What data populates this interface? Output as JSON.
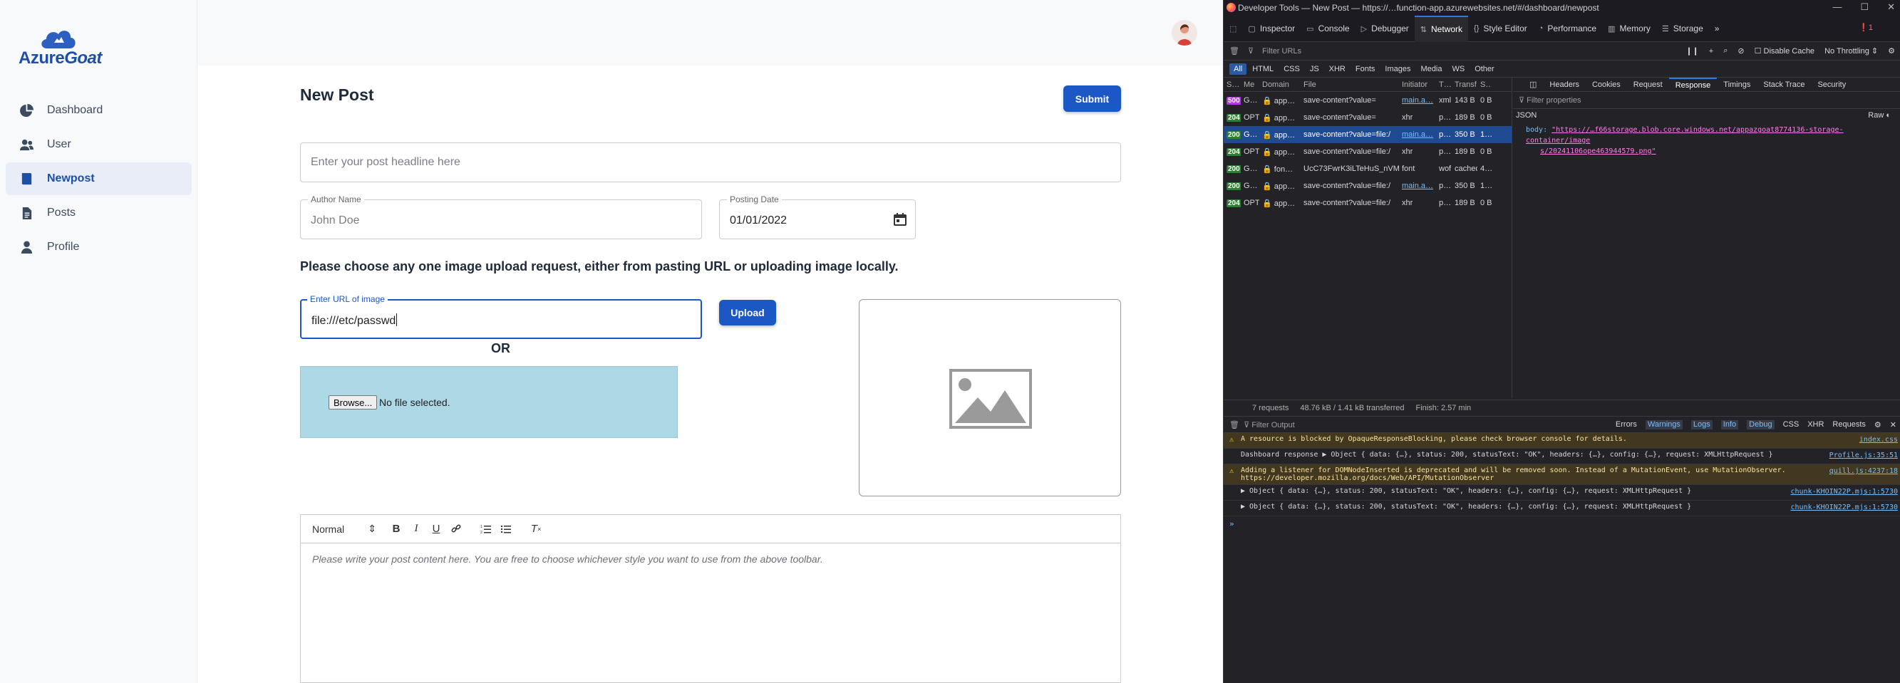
{
  "app": {
    "brand_main": "Azure",
    "brand_goat": "Goat",
    "nav": [
      {
        "label": "Dashboard",
        "icon": "pie-chart-icon"
      },
      {
        "label": "User",
        "icon": "users-icon"
      },
      {
        "label": "Newpost",
        "icon": "book-icon",
        "active": true
      },
      {
        "label": "Posts",
        "icon": "document-icon"
      },
      {
        "label": "Profile",
        "icon": "person-icon"
      }
    ],
    "page_title": "New Post",
    "submit_label": "Submit",
    "headline_placeholder": "Enter your post headline here",
    "author_label": "Author Name",
    "author_placeholder": "John Doe",
    "date_label": "Posting Date",
    "date_value": "01/01/2022",
    "instructions": "Please choose any one image upload request, either from pasting URL or uploading image locally.",
    "url_label": "Enter URL of image",
    "url_value": "file:///etc/passwd",
    "upload_label": "Upload",
    "or_text": "OR",
    "browse_label": "Browse...",
    "no_file_text": "No file selected.",
    "editor": {
      "format_value": "Normal",
      "placeholder": "Please write your post content here. You are free to choose whichever style you want to use from the above toolbar."
    }
  },
  "devtools": {
    "window_title": "Developer Tools — New Post — https://…function-app.azurewebsites.net/#/dashboard/newpost",
    "tabs": [
      "Inspector",
      "Console",
      "Debugger",
      "Network",
      "Style Editor",
      "Performance",
      "Memory",
      "Storage"
    ],
    "active_tab": "Network",
    "error_count": "1",
    "filter_urls_placeholder": "Filter URLs",
    "disable_cache": "Disable Cache",
    "throttling": "No Throttling",
    "type_filters": [
      "All",
      "HTML",
      "CSS",
      "JS",
      "XHR",
      "Fonts",
      "Images",
      "Media",
      "WS",
      "Other"
    ],
    "columns": [
      "S…",
      "Me",
      "Domain",
      "File",
      "Initiator",
      "T…",
      "Transf…",
      "S…"
    ],
    "requests": [
      {
        "status": "500",
        "method": "G…",
        "domain": "app…",
        "file": "save-content?value=",
        "initiator": "main.a…",
        "type": "xml",
        "transferred": "143 B",
        "size": "0 B",
        "initiator_link": true
      },
      {
        "status": "204",
        "method": "OPT",
        "domain": "app…",
        "file": "save-content?value=",
        "initiator": "xhr",
        "type": "p…",
        "transferred": "189 B",
        "size": "0 B",
        "initiator_link": false
      },
      {
        "status": "200",
        "method": "G…",
        "domain": "app…",
        "file": "save-content?value=file:/",
        "initiator": "main.a…",
        "type": "p…",
        "transferred": "350 B",
        "size": "1…",
        "initiator_link": true,
        "selected": true
      },
      {
        "status": "204",
        "method": "OPT",
        "domain": "app…",
        "file": "save-content?value=file:/",
        "initiator": "xhr",
        "type": "p…",
        "transferred": "189 B",
        "size": "0 B",
        "initiator_link": false
      },
      {
        "status": "200",
        "method": "G…",
        "domain": "fon…",
        "file": "UcC73FwrK3iLTeHuS_nVM",
        "initiator": "font",
        "type": "wof",
        "transferred": "cached",
        "size": "4…",
        "initiator_link": false
      },
      {
        "status": "200",
        "method": "G…",
        "domain": "app…",
        "file": "save-content?value=file:/",
        "initiator": "main.a…",
        "type": "p…",
        "transferred": "350 B",
        "size": "1…",
        "initiator_link": true
      },
      {
        "status": "204",
        "method": "OPT",
        "domain": "app…",
        "file": "save-content?value=file:/",
        "initiator": "xhr",
        "type": "p…",
        "transferred": "189 B",
        "size": "0 B",
        "initiator_link": false
      }
    ],
    "status_bar": {
      "requests": "7 requests",
      "size": "48.76 kB / 1.41 kB transferred",
      "finish": "Finish: 2.57 min"
    },
    "response_tabs": [
      "Headers",
      "Cookies",
      "Request",
      "Response",
      "Timings",
      "Stack Trace",
      "Security"
    ],
    "active_response_tab": "Response",
    "filter_properties": "Filter properties",
    "json_label": "JSON",
    "raw_label": "Raw",
    "body_key": "body:",
    "body_value_1": "\"https://…f66storage.blob.core.windows.net/appazgoat8774136-storage-container/image",
    "body_value_2": "s/20241106oрe463944579.png\"",
    "console": {
      "filter_placeholder": "Filter Output",
      "levels": [
        "Errors",
        "Warnings",
        "Logs",
        "Info",
        "Debug",
        "CSS",
        "XHR",
        "Requests"
      ],
      "lines": [
        {
          "type": "warn",
          "text": "A resource is blocked by OpaqueResponseBlocking, please check browser console for details.",
          "src": "index.css"
        },
        {
          "type": "log",
          "text": "Dashboard response ▶ Object { data: {…}, status: 200, statusText: \"OK\", headers: {…}, config: {…}, request: XMLHttpRequest }",
          "src": "Profile.js:35:51"
        },
        {
          "type": "warn",
          "text": "Adding a listener for DOMNodeInserted is deprecated and will be removed soon. Instead of a MutationEvent, use MutationObserver. https://developer.mozilla.org/docs/Web/API/MutationObserver",
          "src": "quill.js:4237:18"
        },
        {
          "type": "log",
          "text": "▶ Object { data: {…}, status: 200, statusText: \"OK\", headers: {…}, config: {…}, request: XMLHttpRequest }",
          "src": "chunk-KHOIN22P.mjs:1:5730"
        },
        {
          "type": "log",
          "text": "▶ Object { data: {…}, status: 200, statusText: \"OK\", headers: {…}, config: {…}, request: XMLHttpRequest }",
          "src": "chunk-KHOIN22P.mjs:1:5730"
        }
      ]
    }
  }
}
